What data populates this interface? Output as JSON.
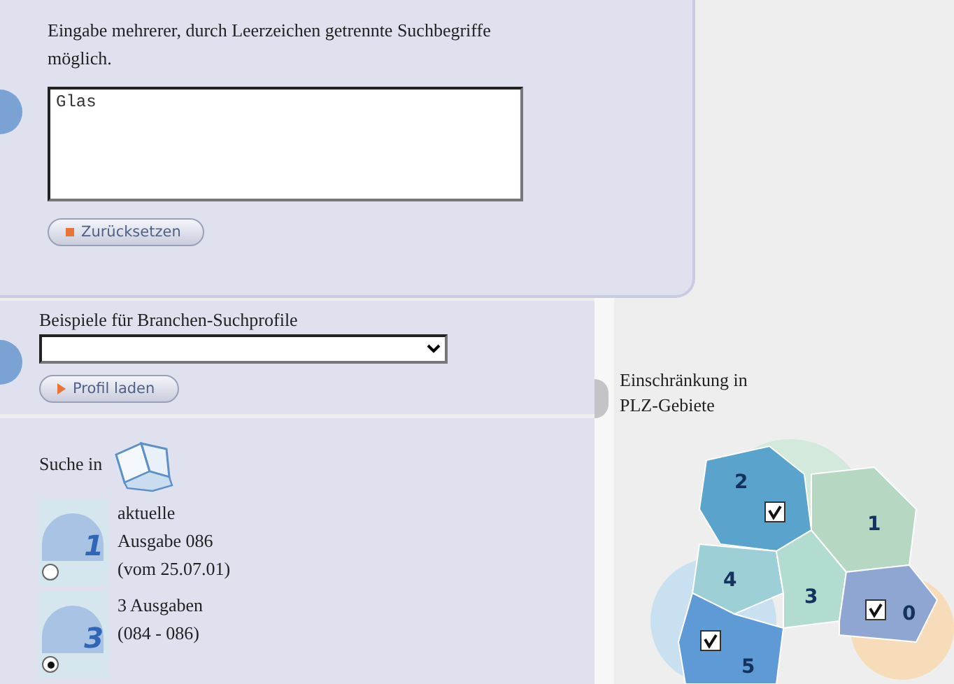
{
  "search": {
    "hint": "Eingabe mehrerer, durch Leerzeichen getrennte Suchbegriffe möglich.",
    "value": "Glas",
    "reset_button": "Zurücksetzen"
  },
  "profiles": {
    "label": "Beispiele für Branchen-Suchprofile",
    "load_button": "Profil laden"
  },
  "scope": {
    "label": "Suche in",
    "options": [
      {
        "number": "1",
        "lines": [
          "aktuelle",
          "Ausgabe 086",
          "(vom 25.07.01)"
        ],
        "selected": false
      },
      {
        "number": "3",
        "lines": [
          "3 Ausgaben",
          "(084 - 086)"
        ],
        "selected": true
      }
    ]
  },
  "plz": {
    "title_lines": [
      "Einschränkung in",
      "PLZ-Gebiete"
    ],
    "regions": [
      {
        "label": "2",
        "checked": true
      },
      {
        "label": "1",
        "checked": false
      },
      {
        "label": "4",
        "checked": false
      },
      {
        "label": "3",
        "checked": false
      },
      {
        "label": "0",
        "checked": true
      },
      {
        "label": "5",
        "checked": true
      }
    ]
  }
}
